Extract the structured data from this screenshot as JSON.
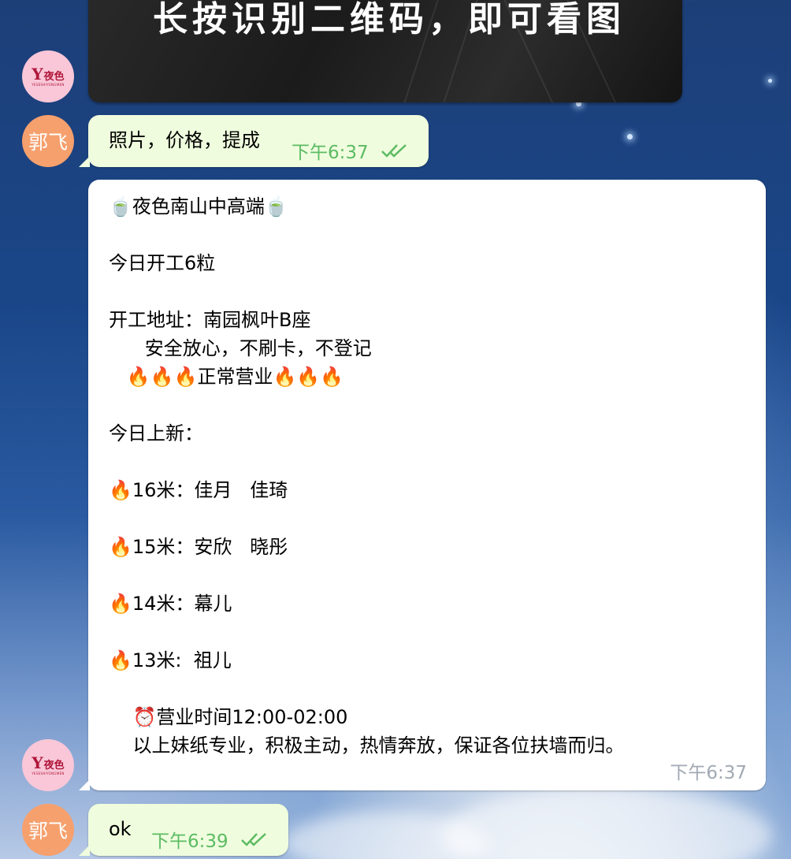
{
  "background": {
    "accent": "#1d3f78"
  },
  "image_message": {
    "caption": "长按识别二维码，即可看图"
  },
  "avatars": {
    "guo_initials": "郭飞",
    "logo": {
      "main_letter": "Y",
      "main_cn": "夜色",
      "sub": "YESESHIYONGMEN"
    }
  },
  "messages": [
    {
      "id": "m1",
      "direction": "out",
      "text": "照片，价格，提成",
      "time": "下午6:37",
      "status": "read"
    },
    {
      "id": "m2",
      "direction": "in",
      "lines": [
        "🍵夜色南山中高端🍵",
        "",
        "今日开工6粒",
        "",
        "开工地址：南园枫叶B座",
        "      安全放心，不刷卡，不登记",
        "   🔥🔥🔥正常营业🔥🔥🔥",
        "",
        "今日上新：",
        "",
        "🔥16米：佳月   佳琦",
        "",
        "🔥15米：安欣   晓彤",
        "",
        "🔥14米：幕儿",
        "",
        "🔥13米:  祖儿",
        "",
        "    ⏰营业时间12:00-02:00",
        "    以上妹纸专业，积极主动，热情奔放，保证各位扶墙而归。"
      ],
      "time": "下午6:37"
    },
    {
      "id": "m3",
      "direction": "out",
      "text": "ok",
      "time": "下午6:39",
      "status": "read"
    }
  ],
  "colors": {
    "outgoing_bubble": "#effdde",
    "incoming_bubble": "#ffffff",
    "read_check": "#5dbb63",
    "time_in": "#a1a9b3"
  }
}
